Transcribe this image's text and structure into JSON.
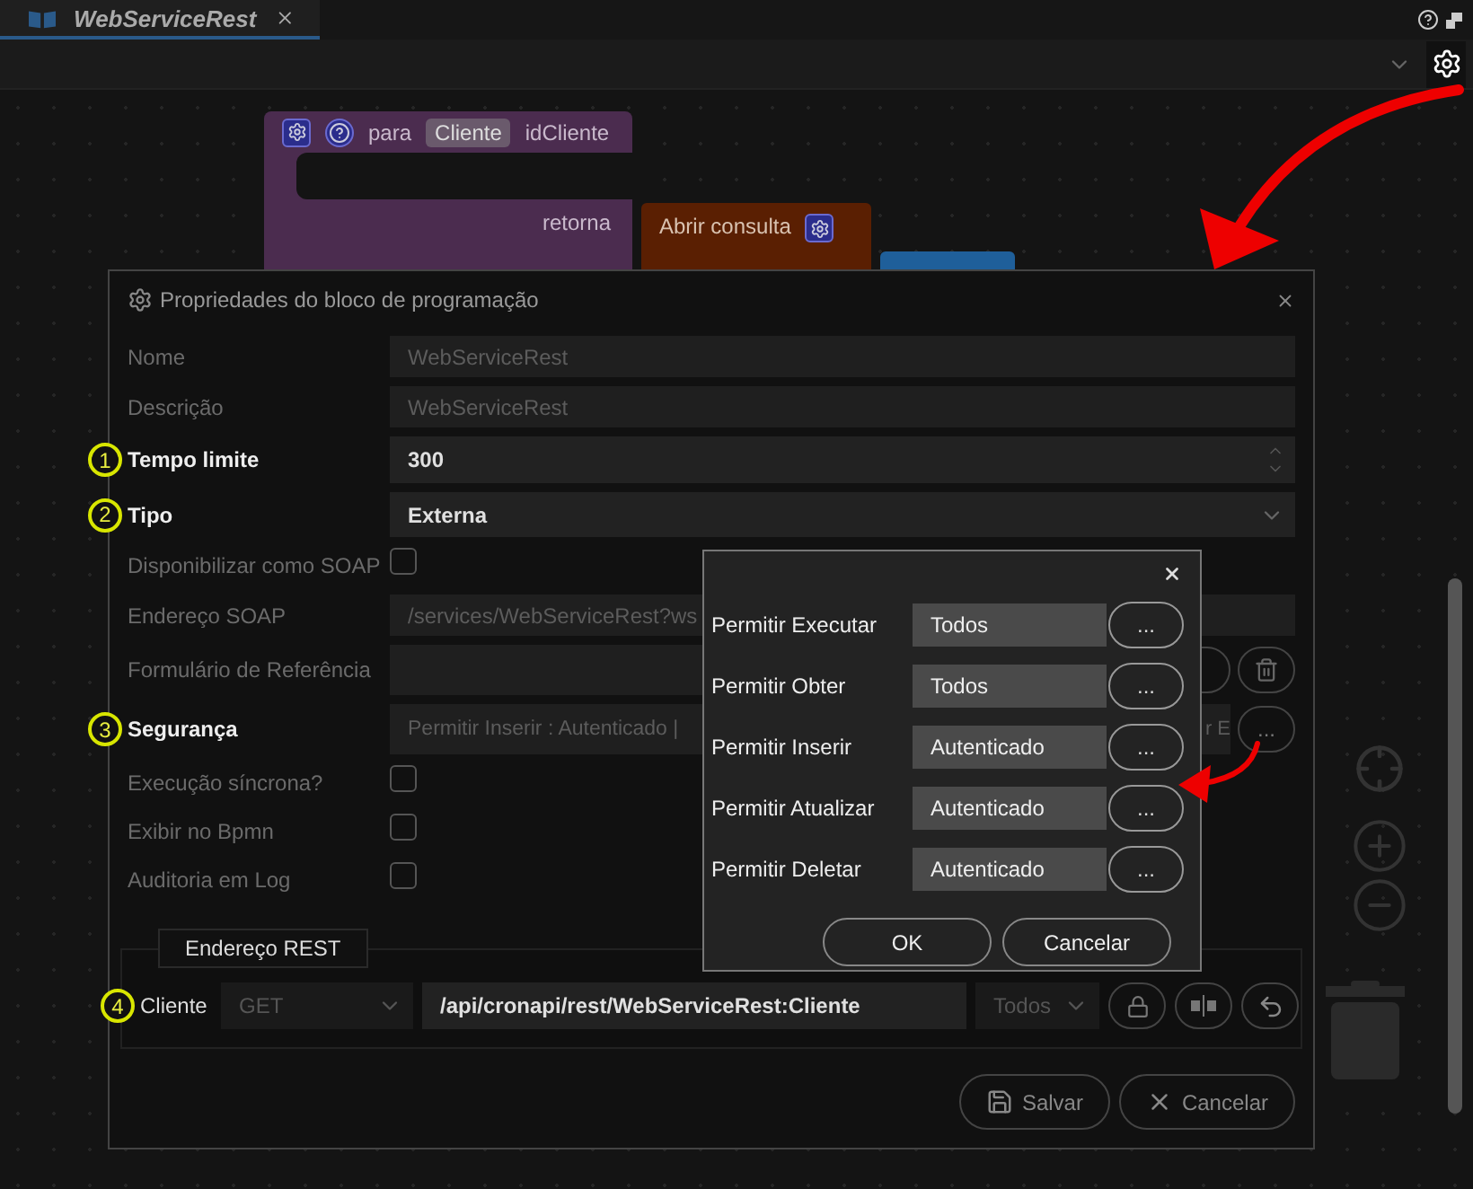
{
  "tabs": [
    {
      "label": "WebServiceRest",
      "selected": true
    }
  ],
  "canvas": {
    "block": {
      "keyword": "para",
      "name": "Cliente",
      "param": "idCliente",
      "return_label": "retorna",
      "call": "Abrir consulta"
    }
  },
  "dialog": {
    "title": "Propriedades do bloco de programação",
    "fields": [
      {
        "kind": "text",
        "label": "Nome",
        "value": "WebServiceRest",
        "disabled": true
      },
      {
        "kind": "text",
        "label": "Descrição",
        "value": "WebServiceRest",
        "disabled": true
      },
      {
        "kind": "number",
        "label": "Tempo limite",
        "value": "300",
        "disabled": false,
        "marker": "1"
      },
      {
        "kind": "select",
        "label": "Tipo",
        "value": "Externa",
        "disabled": false,
        "marker": "2"
      },
      {
        "kind": "checkbox",
        "label": "Disponibilizar como SOAP",
        "checked": false,
        "disabled": true
      },
      {
        "kind": "text",
        "label": "Endereço SOAP",
        "value": "/services/WebServiceRest?ws",
        "disabled": true
      },
      {
        "kind": "lookup",
        "label": "Formulário de Referência",
        "delete": true,
        "disabled": true
      },
      {
        "kind": "lookup",
        "label": "Segurança",
        "value": "Permitir Inserir : Autenticado |",
        "tail": "r E",
        "button": "...",
        "disabled": false,
        "marker": "3"
      },
      {
        "kind": "checkbox",
        "label": "Execução síncrona?",
        "checked": false,
        "disabled": true
      },
      {
        "kind": "checkbox",
        "label": "Exibir no Bpmn",
        "checked": false,
        "disabled": true
      },
      {
        "kind": "checkbox",
        "label": "Auditoria em Log",
        "checked": false,
        "disabled": true
      }
    ],
    "rest": {
      "legend": "Endereço REST",
      "marker": "4",
      "label": "Cliente",
      "method": "GET",
      "url": "/api/cronapi/rest/WebServiceRest:Cliente",
      "access": "Todos"
    },
    "buttons": [
      {
        "kind": "save",
        "label": "Salvar"
      },
      {
        "kind": "cancel",
        "label": "Cancelar"
      }
    ]
  },
  "security_popup": {
    "rows": [
      {
        "label": "Permitir Executar",
        "value": "Todos",
        "button": "..."
      },
      {
        "label": "Permitir Obter",
        "value": "Todos",
        "button": "..."
      },
      {
        "label": "Permitir Inserir",
        "value": "Autenticado",
        "button": "..."
      },
      {
        "label": "Permitir Atualizar",
        "value": "Autenticado",
        "button": "..."
      },
      {
        "label": "Permitir Deletar",
        "value": "Autenticado",
        "button": "..."
      }
    ],
    "buttons": [
      "OK",
      "Cancelar"
    ]
  }
}
